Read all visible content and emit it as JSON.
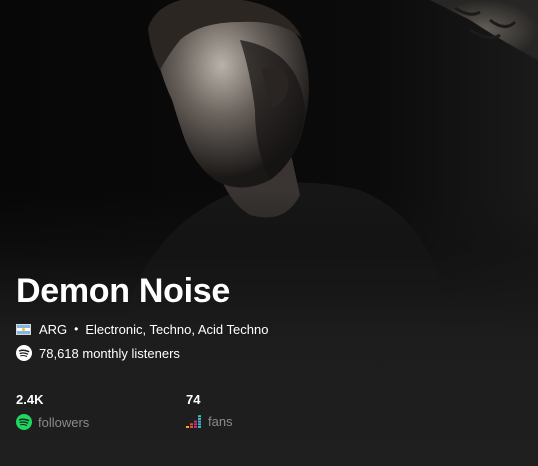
{
  "artist": {
    "name": "Demon Noise",
    "country_code": "ARG",
    "genres": "Electronic, Techno, Acid Techno",
    "monthly_listeners": "78,618 monthly listeners"
  },
  "stats": {
    "followers": {
      "value": "2.4K",
      "label": "followers",
      "source_icon": "spotify-icon"
    },
    "fans": {
      "value": "74",
      "label": "fans",
      "source_icon": "deezer-icon"
    }
  },
  "colors": {
    "spotify_green": "#1ed760",
    "background": "#1f1f1f",
    "muted_text": "#8a8a8a"
  }
}
